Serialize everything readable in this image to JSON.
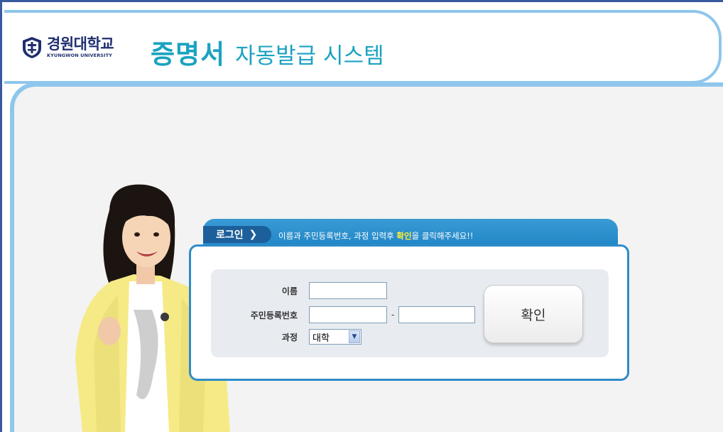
{
  "header": {
    "logo_ko": "경원대학교",
    "logo_en": "KYUNGWON UNIVERSITY",
    "title_main": "증명서",
    "title_sub": "자동발급 시스템"
  },
  "login": {
    "tab_label": "로그인",
    "tab_chevron_icon": "chevron-right-icon",
    "message_before": "이름과 주민등록번호, 과정 입력후 ",
    "message_highlight": "확인",
    "message_after": "을 클릭해주세요!!",
    "name_label": "이름",
    "name_value": "",
    "rrn_label": "주민등록번호",
    "rrn_front_value": "",
    "rrn_back_value": "",
    "rrn_separator": "-",
    "course_label": "과정",
    "course_selected": "대학",
    "confirm_label": "확인"
  },
  "colors": {
    "frame": "#8fc6ec",
    "title": "#1aa3c0",
    "tab": "#1f86c6",
    "highlight": "#ffee33"
  }
}
